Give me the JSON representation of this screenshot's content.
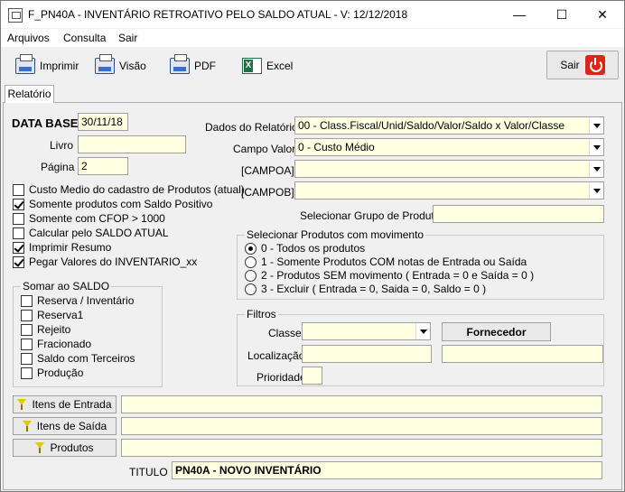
{
  "window": {
    "title": "F_PN40A - INVENTÁRIO RETROATIVO PELO SALDO ATUAL - V: 12/12/2018",
    "minimize": "—",
    "maximize": "☐",
    "close": "✕"
  },
  "menu": {
    "arquivos": "Arquivos",
    "consulta": "Consulta",
    "sair": "Sair"
  },
  "toolbar": {
    "imprimir": "Imprimir",
    "visao": "Visão",
    "pdf": "PDF",
    "excel": "Excel",
    "sair": "Sair"
  },
  "tab": {
    "label": "Relatório"
  },
  "form": {
    "data_base_label": "DATA BASE",
    "data_base_value": "30/11/18",
    "livro_label": "Livro",
    "livro_value": "",
    "pagina_label": "Página",
    "pagina_value": "2",
    "dados_relatorio_label": "Dados do Relatório",
    "dados_relatorio_value": "00 - Class.Fiscal/Unid/Saldo/Valor/Saldo x Valor/Classe",
    "campo_valor_label": "Campo Valor",
    "campo_valor_value": "0 - Custo Médio",
    "campoa_label": "[CAMPOA]",
    "campoa_value": "",
    "campob_label": "[CAMPOB]",
    "campob_value": "",
    "grupo_produtos_label": "Selecionar Grupo de Produtos",
    "grupo_produtos_value": ""
  },
  "options": [
    {
      "label": "Custo Medio do cadastro de Produtos (atual)",
      "checked": false
    },
    {
      "label": "Somente produtos com Saldo Positivo",
      "checked": true
    },
    {
      "label": "Somente com CFOP > 1000",
      "checked": false
    },
    {
      "label": "Calcular pelo SALDO ATUAL",
      "checked": false
    },
    {
      "label": "Imprimir Resumo",
      "checked": true
    },
    {
      "label": "Pegar Valores  do INVENTARIO_xx",
      "checked": true
    }
  ],
  "somar": {
    "title": "Somar ao SALDO",
    "items": [
      {
        "label": "Reserva / Inventário",
        "checked": false
      },
      {
        "label": "Reserva1",
        "checked": false
      },
      {
        "label": "Rejeito",
        "checked": false
      },
      {
        "label": "Fracionado",
        "checked": false
      },
      {
        "label": "Saldo com Terceiros",
        "checked": false
      },
      {
        "label": "Produção",
        "checked": false
      }
    ]
  },
  "movimento": {
    "title": "Selecionar Produtos com movimento",
    "items": [
      {
        "label": "0 - Todos os produtos",
        "selected": true
      },
      {
        "label": "1 - Somente Produtos COM notas de Entrada ou Saída",
        "selected": false
      },
      {
        "label": "2 - Produtos SEM movimento  ( Entrada = 0 e Saída = 0 )",
        "selected": false
      },
      {
        "label": "3 - Excluir ( Entrada = 0, Saida = 0, Saldo = 0 )",
        "selected": false
      }
    ]
  },
  "filtros": {
    "title": "Filtros",
    "classe_label": "Classe:",
    "classe_value": "",
    "fornecedor_button": "Fornecedor",
    "fornecedor_value": "",
    "localizacao_label": "Localização",
    "localizacao_value": "",
    "prioridade_label": "Prioridade",
    "prioridade_value": ""
  },
  "bottom": {
    "itens_entrada": "Itens de Entrada",
    "itens_entrada_value": "",
    "itens_saida": "Itens de Saída",
    "itens_saida_value": "",
    "produtos": "Produtos",
    "produtos_value": "",
    "titulo_label": "TITULO",
    "titulo_value": "PN40A - NOVO INVENTÁRIO"
  }
}
